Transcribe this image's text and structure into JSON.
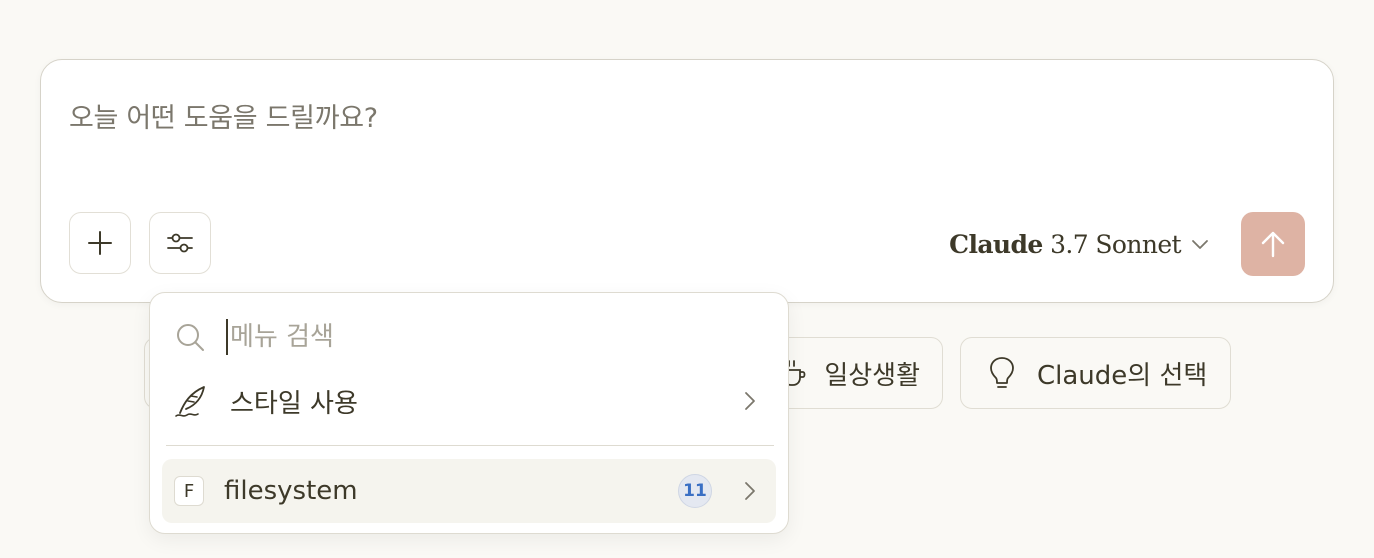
{
  "composer": {
    "placeholder": "오늘 어떤 도움을 드릴까요?",
    "add_icon": "plus-icon",
    "tools_icon": "sliders-icon",
    "model": {
      "brand": "Claude",
      "version": "3.7 Sonnet",
      "icon": "chevron-down-icon"
    },
    "send_icon": "arrow-up-icon",
    "send_color": "#deb3a4"
  },
  "suggestions": [
    {
      "label": "일상생활",
      "icon": "coffee-cup-icon"
    },
    {
      "label": "Claude의 선택",
      "icon": "lightbulb-icon"
    }
  ],
  "menu": {
    "search_placeholder": "메뉴 검색",
    "search_icon": "search-icon",
    "items": [
      {
        "label": "스타일 사용",
        "icon": "quill-icon"
      },
      {
        "label": "filesystem",
        "icon_letter": "F",
        "count": "11"
      }
    ],
    "badge_color": "#3a6fc4"
  }
}
